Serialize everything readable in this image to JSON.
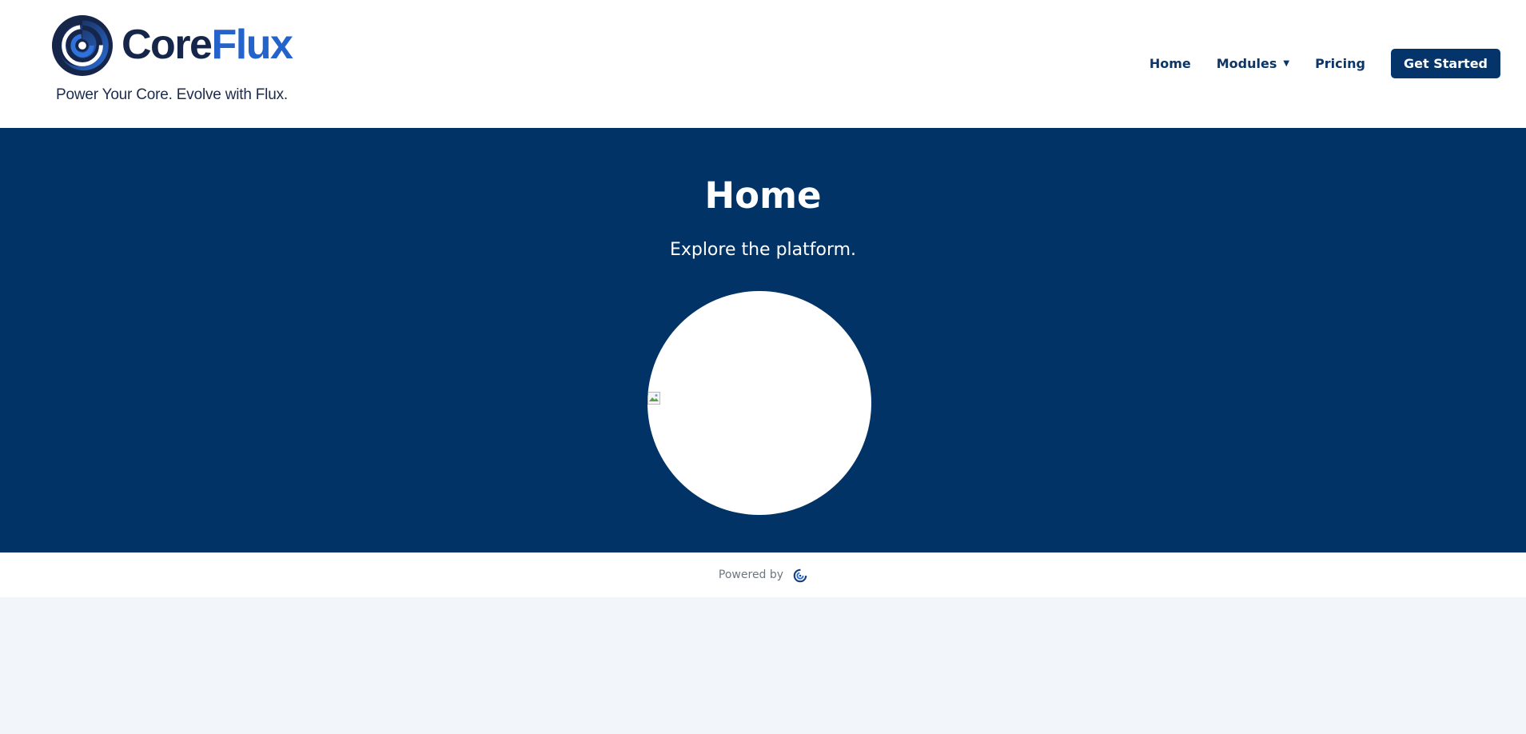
{
  "brand": {
    "name_core": "Core",
    "name_flux": "Flux",
    "tagline": "Power Your Core. Evolve with Flux.",
    "logo_icon": "swirl-logo-icon",
    "colors": {
      "navy": "#16264a",
      "blue": "#2463c9"
    }
  },
  "nav": {
    "items": [
      {
        "label": "Home"
      },
      {
        "label": "Modules",
        "has_dropdown": true,
        "dropdown_icon": "caret-down-icon"
      },
      {
        "label": "Pricing"
      }
    ],
    "cta_label": "Get Started"
  },
  "hero": {
    "title": "Home",
    "subtitle": "Explore the platform.",
    "image_icon": "broken-image-icon",
    "background_color": "#013366"
  },
  "footer": {
    "powered_by": "Powered by",
    "icon": "swirl-logo-icon"
  }
}
